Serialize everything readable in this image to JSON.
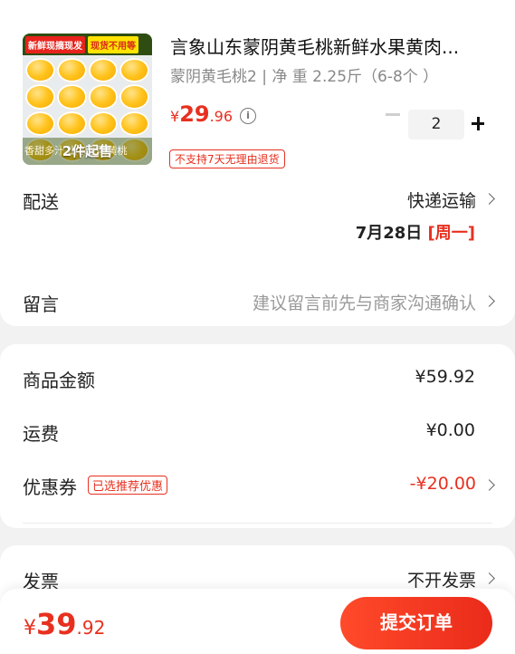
{
  "product": {
    "thumb_tag_left": "新鲜现摘现发",
    "thumb_tag_right": "现货不用等",
    "thumb_overlay_text": "香甜多汁 山东蒙阴黄桃",
    "min_purchase": "2件起售",
    "title": "言象山东蒙阴黄毛桃新鲜水果黄肉...",
    "spec": "蒙阴黄毛桃2 | 净 重 2.25斤（6-8个 ）",
    "price_currency": "¥",
    "price_int": "29",
    "price_dec": ".96",
    "info_icon": "i",
    "quantity": "2",
    "no_return_tag": "不支持7天无理由退货"
  },
  "delivery": {
    "label": "配送",
    "method": "快递运输",
    "date": "7月28日",
    "weekday": "[周一]"
  },
  "message": {
    "label": "留言",
    "placeholder": "建议留言前先与商家沟通确认"
  },
  "summary": {
    "goods_label": "商品金额",
    "goods_value": "¥59.92",
    "shipping_label": "运费",
    "shipping_value": "¥0.00",
    "coupon_label": "优惠券",
    "coupon_tag": "已选推荐优惠",
    "coupon_value": "-¥20.00"
  },
  "invoice": {
    "label": "发票",
    "value": "不开发票"
  },
  "footer": {
    "total_currency": "¥",
    "total_int": "39",
    "total_dec": ".92",
    "submit_label": "提交订单"
  },
  "colors": {
    "accent_red": "#e8301f",
    "background": "#f2f2f2"
  }
}
